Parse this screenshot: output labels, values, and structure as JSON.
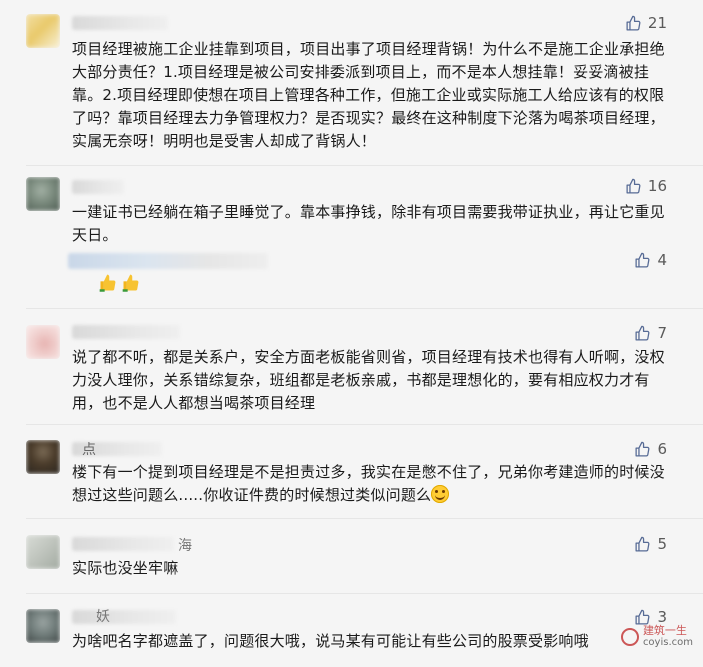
{
  "comments": [
    {
      "likes": "21",
      "text": "项目经理被施工企业挂靠到项目，项目出事了项目经理背锅！为什么不是施工企业承担绝大部分责任？1.项目经理是被公司安排委派到项目上，而不是本人想挂靠！妥妥滴被挂靠。2.项目经理即使想在项目上管理各种工作，但施工企业或实际施工人给应该有的权限了吗？靠项目经理去力争管理权力？是否现实？最终在这种制度下沦落为喝茶项目经理，实属无奈呀！明明也是受害人却成了背锅人！",
      "avatar_colors": [
        "#f3e0a6",
        "#e9c96a",
        "#f8f1d8"
      ]
    },
    {
      "likes": "16",
      "text": "一建证书已经躺在箱子里睡觉了。靠本事挣钱，除非有项目需要我带证执业，再让它重见天日。",
      "avatar_colors": [
        "#7a8a7d",
        "#4e5d53",
        "#a2b0a4"
      ]
    },
    {
      "likes": "4",
      "text": "",
      "is_reply": true
    },
    {
      "likes": "7",
      "text": "说了都不听，都是关系户，安全方面老板能省则省，项目经理有技术也得有人听啊，没权力没人理你，关系错综复杂，班组都是老板亲戚，书都是理想化的，要有相应权力才有用，也不是人人都想当喝茶项目经理",
      "avatar_colors": [
        "#f1d2d0",
        "#e7b3b1",
        "#fbeceb"
      ]
    },
    {
      "likes": "6",
      "name_fragment": "点",
      "text": "楼下有一个提到项目经理是不是担责过多，我实在是憋不住了，兄弟你考建造师的时候没想过这些问题么.....你收证件费的时候想过类似问题么",
      "avatar_colors": [
        "#4a3b2a",
        "#2b2620",
        "#7a6a55"
      ]
    },
    {
      "likes": "5",
      "name_fragment": "海",
      "text": "实际也没坐牢嘛",
      "avatar_colors": [
        "#bfc4bd",
        "#a3aba2",
        "#d8dcd6"
      ]
    },
    {
      "likes": "3",
      "name_fragment": "妖",
      "text": "为啥吧名字都遮盖了，问题很大哦，说马某有可能让有些公司的股票受影响哦",
      "avatar_colors": [
        "#6e7a78",
        "#3f4746",
        "#9aa4a2"
      ]
    }
  ],
  "watermark": {
    "line1": "建筑一生",
    "url": "coyis.com"
  }
}
